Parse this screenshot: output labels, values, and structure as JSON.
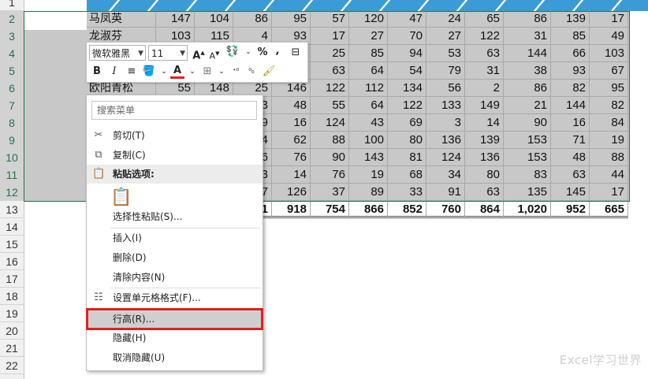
{
  "row_numbers": [
    "1",
    "2",
    "3",
    "4",
    "5",
    "6",
    "7",
    "8",
    "9",
    "10",
    "11",
    "12",
    "13",
    "14",
    "15",
    "16",
    "17",
    "18",
    "19",
    "20",
    "21",
    "22"
  ],
  "table": {
    "rows": [
      {
        "name": "马凤英",
        "values": [
          "147",
          "104",
          "86",
          "95",
          "57",
          "120",
          "47",
          "24",
          "65",
          "86",
          "139",
          "17"
        ]
      },
      {
        "name": "龙淑芬",
        "values": [
          "103",
          "115",
          "4",
          "93",
          "17",
          "27",
          "70",
          "27",
          "122",
          "31",
          "85",
          "49"
        ]
      },
      {
        "name": "",
        "values": [
          "",
          "",
          "",
          "",
          "25",
          "85",
          "94",
          "53",
          "63",
          "144",
          "66",
          "103"
        ]
      },
      {
        "name": "",
        "values": [
          "",
          "",
          "",
          "",
          "63",
          "64",
          "54",
          "79",
          "31",
          "38",
          "93",
          "67"
        ]
      },
      {
        "name": "欧阳青松",
        "values": [
          "55",
          "148",
          "25",
          "146",
          "122",
          "112",
          "134",
          "56",
          "2",
          "86",
          "82",
          "95"
        ]
      },
      {
        "name": "",
        "values": [
          "",
          "",
          "3",
          "48",
          "55",
          "64",
          "122",
          "133",
          "149",
          "21",
          "144",
          "82"
        ]
      },
      {
        "name": "",
        "values": [
          "",
          "",
          "9",
          "16",
          "124",
          "43",
          "69",
          "3",
          "14",
          "90",
          "16",
          "84"
        ]
      },
      {
        "name": "",
        "values": [
          "",
          "",
          "4",
          "62",
          "88",
          "100",
          "80",
          "136",
          "139",
          "153",
          "71",
          "19"
        ]
      },
      {
        "name": "",
        "values": [
          "",
          "",
          "6",
          "76",
          "90",
          "143",
          "81",
          "124",
          "136",
          "153",
          "48",
          "88"
        ]
      },
      {
        "name": "",
        "values": [
          "",
          "",
          "3",
          "14",
          "76",
          "19",
          "68",
          "34",
          "80",
          "83",
          "63",
          "44"
        ]
      },
      {
        "name": "",
        "values": [
          "",
          "",
          "7",
          "126",
          "37",
          "89",
          "33",
          "91",
          "63",
          "135",
          "145",
          "17"
        ]
      }
    ],
    "totals": [
      "",
      "",
      "1",
      "918",
      "754",
      "866",
      "852",
      "760",
      "864",
      "1,020",
      "952",
      "665"
    ]
  },
  "mini_toolbar": {
    "font_name": "微软雅黑",
    "font_size": "11",
    "grow_font": "A",
    "shrink_font": "A",
    "percent": "%",
    "comma": ",",
    "bold": "B",
    "italic": "I",
    "font_color_letter": "A"
  },
  "context_menu": {
    "search_placeholder": "搜索菜单",
    "cut": "剪切(T)",
    "copy": "复制(C)",
    "paste_options": "粘贴选项:",
    "paste_special": "选择性粘贴(S)...",
    "insert": "插入(I)",
    "delete": "删除(D)",
    "clear_contents": "清除内容(N)",
    "format_cells": "设置单元格格式(F)...",
    "row_height": "行高(R)...",
    "hide": "隐藏(H)",
    "unhide": "取消隐藏(U)"
  },
  "watermark": "Excel学习世界",
  "colors": {
    "selection_border": "#217346",
    "selection_fill": "#c8c8c8",
    "highlight_box": "#e02020",
    "header_accent": "#3a9bd6"
  }
}
